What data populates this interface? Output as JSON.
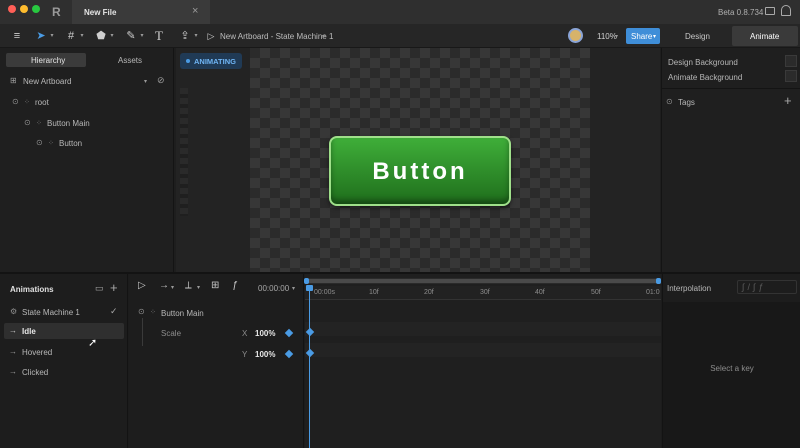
{
  "window": {
    "tab_title": "New File",
    "version": "Beta 0.8.734"
  },
  "toolbar": {
    "breadcrumb": "New Artboard - State Machine 1",
    "zoom": "110%",
    "share_label": "Share",
    "mode_tabs": [
      "Design",
      "Animate"
    ],
    "active_mode": "Animate"
  },
  "left_panel": {
    "tabs": [
      "Hierarchy",
      "Assets"
    ],
    "artboard": "New Artboard",
    "tree": [
      "root",
      "Button Main",
      "Button"
    ]
  },
  "canvas": {
    "status": "ANIMATING",
    "button_label": "Button"
  },
  "right_panel": {
    "design_background": "Design Background",
    "animate_background": "Animate Background",
    "tags": "Tags"
  },
  "animations": {
    "title": "Animations",
    "items": [
      "State Machine 1",
      "Idle",
      "Hovered",
      "Clicked"
    ],
    "selected": "Idle"
  },
  "timeline": {
    "time": "00:00:00",
    "object": "Button Main",
    "property": "Scale",
    "x_label": "X",
    "x_value": "100%",
    "y_label": "Y",
    "y_value": "100%",
    "ticks": [
      "00:00s",
      "10f",
      "20f",
      "30f",
      "40f",
      "50f",
      "01:0"
    ]
  },
  "interpolation": {
    "title": "Interpolation",
    "empty": "Select a key"
  },
  "colors": {
    "accent": "#3f8ed8",
    "button_green": "#2e8a2a",
    "keyframe": "#4a9be4"
  }
}
